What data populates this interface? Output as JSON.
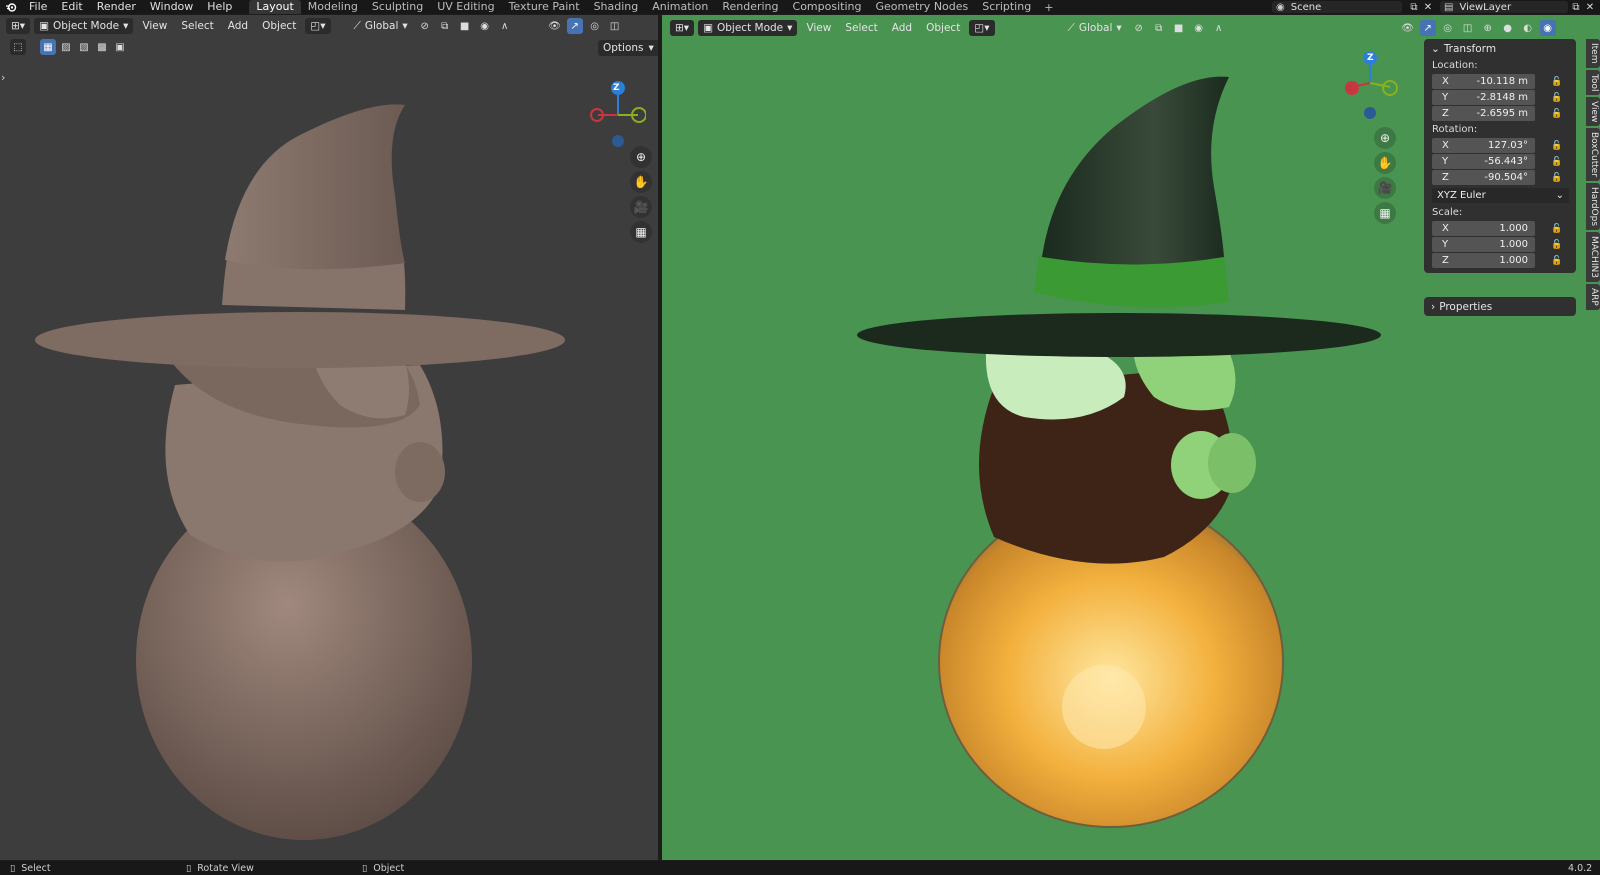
{
  "app": {
    "menus": [
      "File",
      "Edit",
      "Render",
      "Window",
      "Help"
    ],
    "workspaces": [
      "Layout",
      "Modeling",
      "Sculpting",
      "UV Editing",
      "Texture Paint",
      "Shading",
      "Animation",
      "Rendering",
      "Compositing",
      "Geometry Nodes",
      "Scripting"
    ],
    "active_workspace": "Layout",
    "scene": "Scene",
    "view_layer": "ViewLayer"
  },
  "left_viewport": {
    "mode": "Object Mode",
    "menus": [
      "View",
      "Select",
      "Add",
      "Object"
    ],
    "orientation": "Global",
    "options": "Options",
    "gizmo_z": "Z"
  },
  "right_viewport": {
    "mode": "Object Mode",
    "menus": [
      "View",
      "Select",
      "Add",
      "Object"
    ],
    "orientation": "Global",
    "gizmo_z": "Z",
    "background_color": "#4a9452"
  },
  "npanel": {
    "transform_title": "Transform",
    "location_label": "Location:",
    "location": [
      {
        "axis": "X",
        "value": "-10.118 m"
      },
      {
        "axis": "Y",
        "value": "-2.8148 m"
      },
      {
        "axis": "Z",
        "value": "-2.6595 m"
      }
    ],
    "rotation_label": "Rotation:",
    "rotation": [
      {
        "axis": "X",
        "value": "127.03°"
      },
      {
        "axis": "Y",
        "value": "-56.443°"
      },
      {
        "axis": "Z",
        "value": "-90.504°"
      }
    ],
    "rotation_mode": "XYZ Euler",
    "scale_label": "Scale:",
    "scale": [
      {
        "axis": "X",
        "value": "1.000"
      },
      {
        "axis": "Y",
        "value": "1.000"
      },
      {
        "axis": "Z",
        "value": "1.000"
      }
    ],
    "properties_title": "Properties",
    "tabs": [
      "Item",
      "Tool",
      "View",
      "BoxCutter",
      "HardOps",
      "MACHIN3",
      "ARP"
    ]
  },
  "status": {
    "select": "Select",
    "rotate": "Rotate View",
    "object": "Object",
    "version": "4.0.2"
  },
  "colors": {
    "accent": "#4772b3",
    "axis_x": "#c8363f",
    "axis_y": "#8ab11d",
    "axis_z": "#2c7fd6"
  }
}
